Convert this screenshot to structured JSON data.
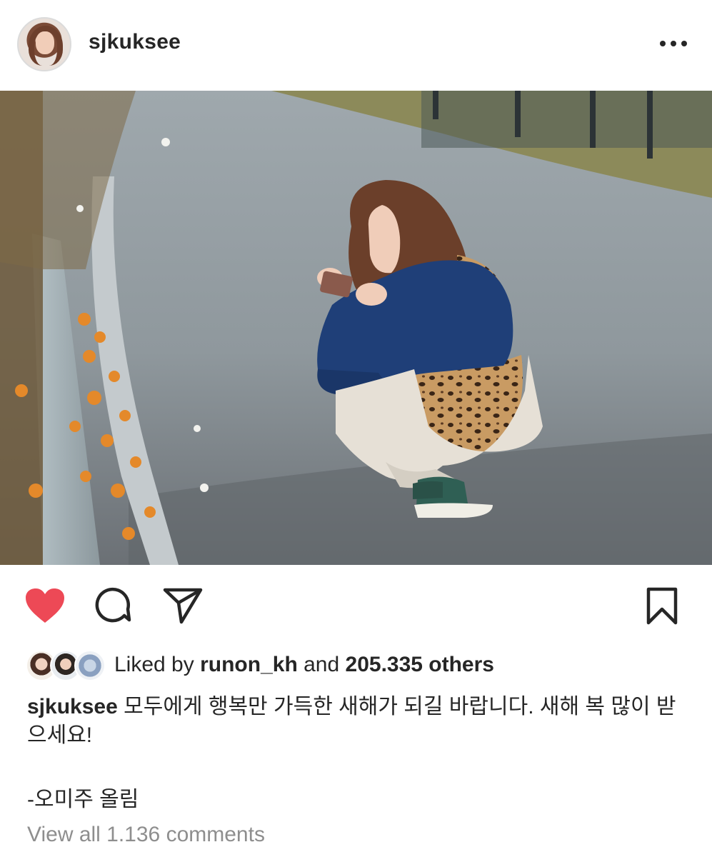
{
  "post": {
    "username": "sjkuksee",
    "caption": "모두에게 행복만 가득한 새해가 되길 바랍니다. 새해 복 많이 받으세요!",
    "signoff": "-오미주 올림"
  },
  "likes": {
    "prefix": "Liked by",
    "user": "runon_kh",
    "middle": "and",
    "count": "205.335 others"
  },
  "comments": {
    "view_all": "View all 1.136 comments"
  },
  "icons": {
    "more": "more-options-icon",
    "like": "heart-icon",
    "comment": "comment-icon",
    "share": "send-icon",
    "save": "bookmark-icon"
  },
  "colors": {
    "like_active": "#ed4956",
    "muted_text": "#8e8e8e",
    "text": "#262626"
  }
}
